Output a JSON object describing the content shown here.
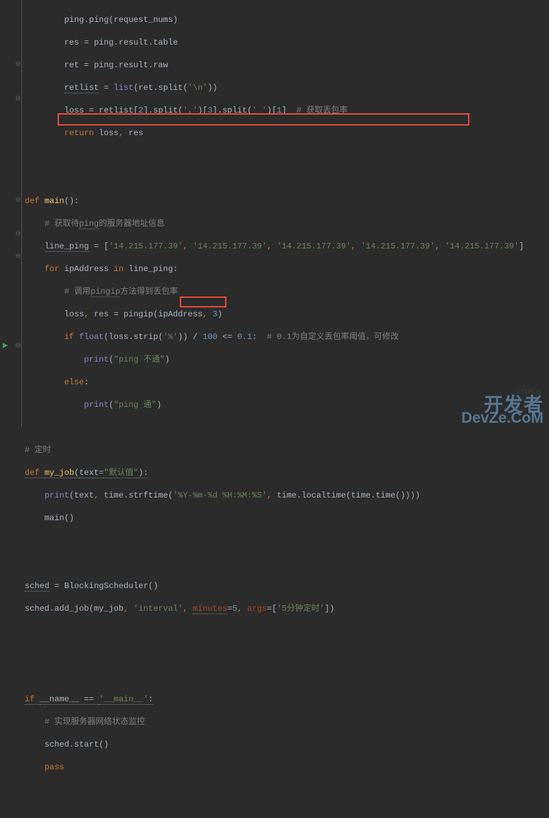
{
  "code": {
    "l1_a": "        ping.ping(request_nums)",
    "l2_a": "        res = ping.result.table",
    "l3_a": "        ret = ping.result.raw",
    "l4_a": "        ",
    "l4_b": "retlist",
    "l4_c": " = ",
    "l4_d": "list",
    "l4_e": "(ret.split(",
    "l4_f": "'\\n'",
    "l4_g": "))",
    "l5_a": "        loss = retlist[",
    "l5_b": "2",
    "l5_c": "].split(",
    "l5_d": "','",
    "l5_e": ")[",
    "l5_f": "3",
    "l5_g": "].split(",
    "l5_h": "' '",
    "l5_i": ")[",
    "l5_j": "1",
    "l5_k": "]  ",
    "l5_l": "# 获取丢包率",
    "l6_a": "        ",
    "l6_b": "return ",
    "l6_c": "loss",
    "l6_d": ", ",
    "l6_e": "res",
    "l9_a": "def ",
    "l9_b": "main",
    "l9_c": "():",
    "l10_a": "    ",
    "l10_b": "# 获取待",
    "l10_c": "ping",
    "l10_d": "的服务器地址信息",
    "l11_a": "    ",
    "l11_b": "line_ping",
    "l11_c": " = [",
    "l11_d": "'14.215.177.39'",
    "l11_e": ", ",
    "l11_f": "'14.215.177.39'",
    "l11_g": ", ",
    "l11_h": "'14.215.177.39'",
    "l11_i": ", ",
    "l11_j": "'14.215.177.39'",
    "l11_k": ", ",
    "l11_l": "'14.215.177.39'",
    "l11_m": "]",
    "l12_a": "    ",
    "l12_b": "for ",
    "l12_c": "ipAddress ",
    "l12_d": "in ",
    "l12_e": "line_ping:",
    "l13_a": "        ",
    "l13_b": "# 调用",
    "l13_c": "pingip",
    "l13_d": "方法得到丢包率",
    "l14_a": "        loss",
    "l14_b": ", ",
    "l14_c": "res = pingip(ipAddress",
    "l14_d": ", ",
    "l14_e": "3",
    "l14_f": ")",
    "l15_a": "        ",
    "l15_b": "if ",
    "l15_c": "float",
    "l15_d": "(loss.strip(",
    "l15_e": "'%'",
    "l15_f": ")) / ",
    "l15_g": "100 ",
    "l15_h": "<= ",
    "l15_i": "0.1",
    "l15_j": ":  ",
    "l15_k": "# 0.1为自定义丢包率阈值，可修改",
    "l16_a": "            ",
    "l16_b": "print",
    "l16_c": "(",
    "l16_d": "\"ping 不通\"",
    "l16_e": ")",
    "l17_a": "        ",
    "l17_b": "else",
    "l17_c": ":",
    "l18_a": "            ",
    "l18_b": "print",
    "l18_c": "(",
    "l18_d": "\"ping 通\"",
    "l18_e": ")",
    "l20_a": "# 定时",
    "l21_a": "def ",
    "l21_b": "my_job",
    "l21_c": "(",
    "l21_d": "text=",
    "l21_e": "\"默认值\"",
    "l21_f": "):",
    "l22_a": "    ",
    "l22_b": "print",
    "l22_c": "(text",
    "l22_d": ", ",
    "l22_e": "time.strftime(",
    "l22_f": "'%Y-%m-%d %H:%M:%S'",
    "l22_g": ", ",
    "l22_h": "time.localtime(time.time())))",
    "l23_a": "    main()",
    "l26_a": "sched",
    "l26_b": " = BlockingScheduler()",
    "l27_a": "sched.add_job(my_job",
    "l27_b": ", ",
    "l27_c": "'interval'",
    "l27_d": ", ",
    "l27_e": "minutes",
    "l27_f": "=",
    "l27_g": "5",
    "l27_h": ", ",
    "l27_i": "args",
    "l27_j": "=[",
    "l27_k": "'5分钟定时'",
    "l27_l": "])",
    "l31_a": "if ",
    "l31_b": "__name__ == ",
    "l31_c": "'__main__'",
    "l31_d": ":",
    "l32_a": "    ",
    "l32_b": "# 实现服务器网络状态监控",
    "l33_a": "    sched.start()",
    "l34_a": "    ",
    "l34_b": "pass"
  },
  "watermark": {
    "line1": "开发者",
    "line2": "DevZe.CoM",
    "csdn": "CSDN @"
  },
  "gutter": {
    "collapse": "⊖",
    "expand": "⊕",
    "run": "▶"
  }
}
